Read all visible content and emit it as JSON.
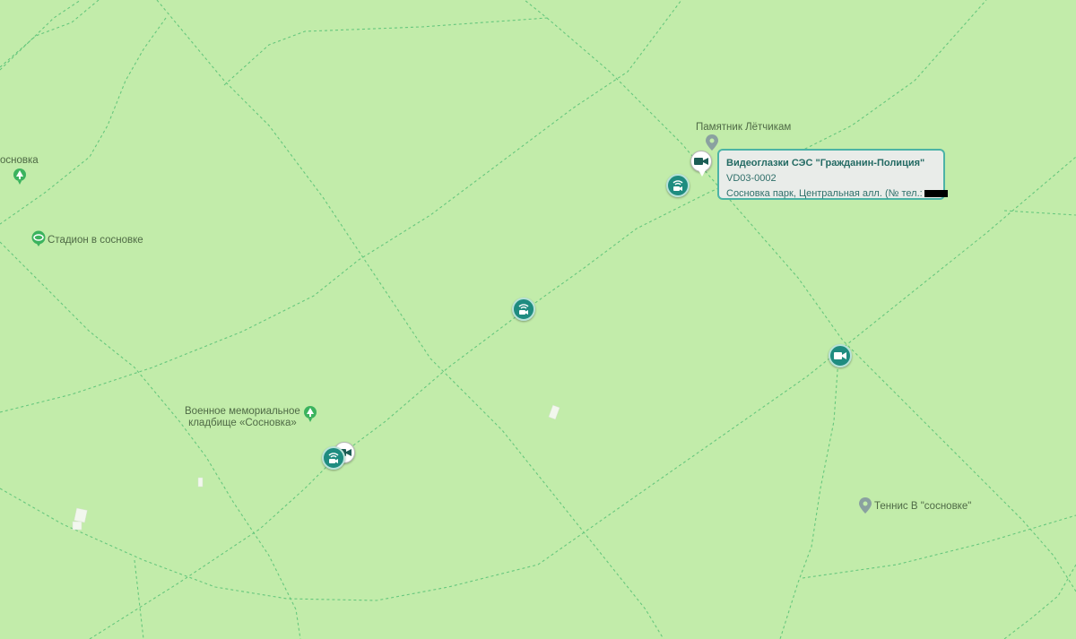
{
  "map": {
    "colors": {
      "background": "#c2ecaa",
      "path": "#66c77d",
      "marker": "#1f8c80",
      "pin": "#8aa1a0"
    },
    "pois": [
      {
        "id": "sosnovka-park",
        "label": "основка",
        "icon": "tree-icon"
      },
      {
        "id": "stadium",
        "label": "Стадион в сосновке",
        "icon": "stadium-icon"
      },
      {
        "id": "monument",
        "label": "Памятник Лётчикам",
        "icon": "location-pin-icon"
      },
      {
        "id": "cemetery",
        "label_lines": [
          "Военное мемориальное",
          "кладбище «Сосновка»"
        ],
        "icon": "tree-icon"
      },
      {
        "id": "tennis",
        "label": "Теннис В \"сосновке\"",
        "icon": "location-pin-icon"
      }
    ],
    "markers": [
      {
        "id": "m1",
        "icon": "wifi-camera-icon"
      },
      {
        "id": "m2",
        "icon": "wifi-camera-icon"
      },
      {
        "id": "m3",
        "icon": "wifi-camera-icon"
      },
      {
        "id": "m4",
        "icon": "camera-icon"
      },
      {
        "id": "pin1",
        "icon": "camera-icon"
      },
      {
        "id": "pin2",
        "icon": "camera-icon"
      }
    ]
  },
  "tooltip": {
    "title": "Видеоглазки СЭС \"Гражданин-Полиция\"",
    "id_code": "VD03-0002",
    "address": "Сосновка парк, Центральная алл. (№ тел.:"
  }
}
